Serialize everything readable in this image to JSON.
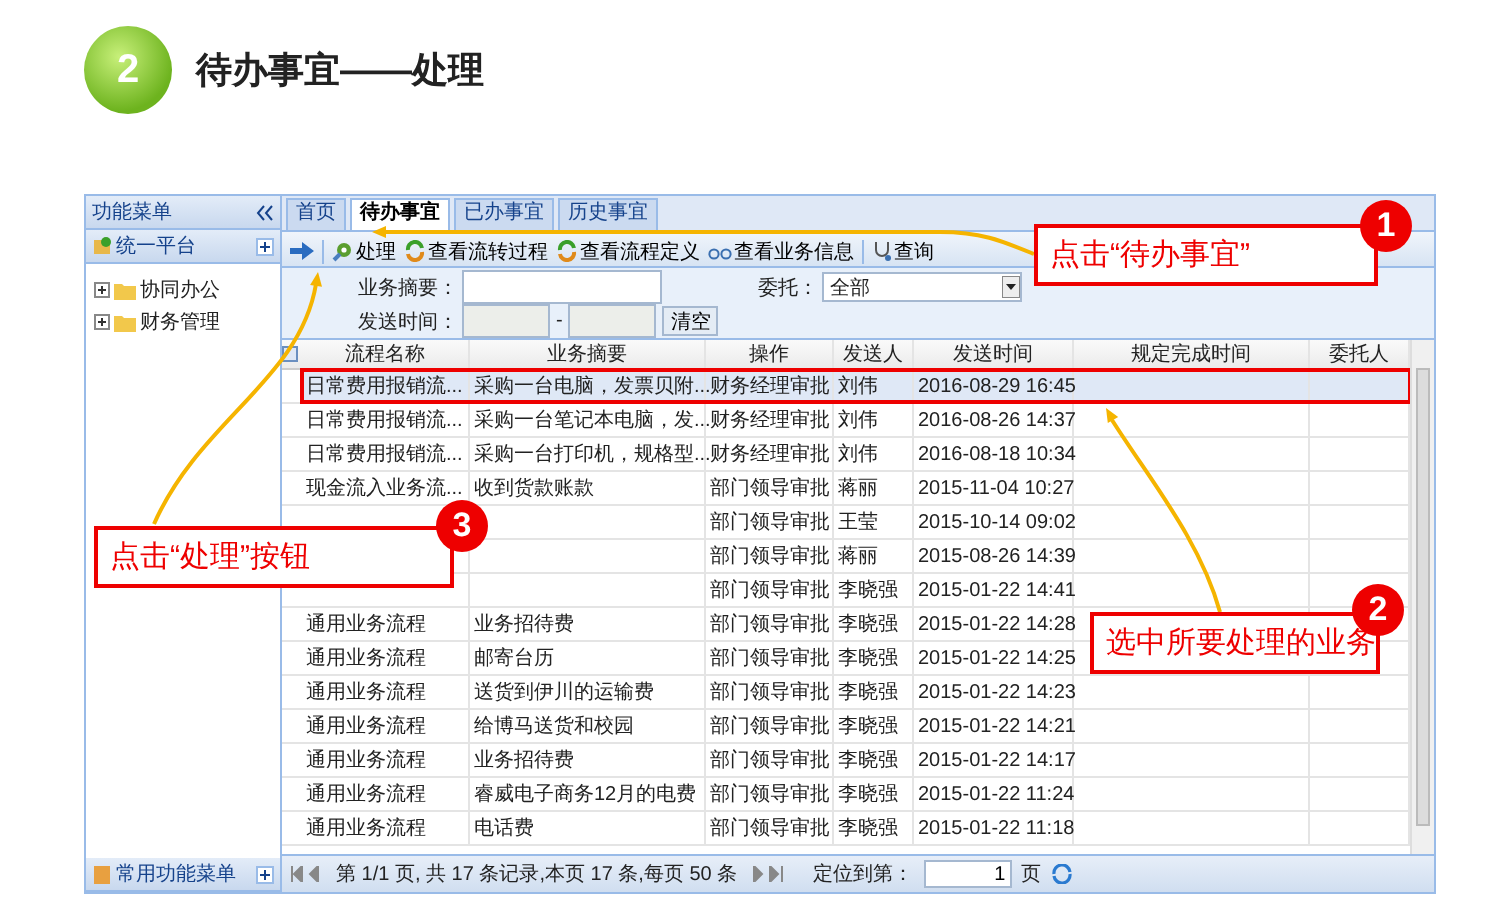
{
  "slide": {
    "step": "2",
    "title": "待办事宜——处理"
  },
  "sidebar": {
    "title": "功能菜单",
    "section": "统一平台",
    "tree": [
      {
        "label": "协同办公",
        "expanded": false
      },
      {
        "label": "财务管理",
        "expanded": false
      }
    ],
    "footer": "常用功能菜单"
  },
  "tabs": [
    {
      "label": "首页",
      "selected": false
    },
    {
      "label": "待办事宜",
      "selected": true
    },
    {
      "label": "已办事宜",
      "selected": false
    },
    {
      "label": "历史事宜",
      "selected": false
    }
  ],
  "toolbar": [
    {
      "label": "处理",
      "kind": "process"
    },
    {
      "label": "查看流转过程",
      "kind": "recycle"
    },
    {
      "label": "查看流程定义",
      "kind": "recycle"
    },
    {
      "label": "查看业务信息",
      "kind": "glasses"
    },
    {
      "label": "查询",
      "kind": "query"
    }
  ],
  "form": {
    "summary_label": "业务摘要：",
    "delegate_label": "委托：",
    "delegate_value": "全部",
    "time_label": "发送时间：",
    "range_separator": "-",
    "clear_button": "清空"
  },
  "table": {
    "columns": [
      "流程名称",
      "业务摘要",
      "操作",
      "发送人",
      "发送时间",
      "规定完成时间",
      "委托人"
    ],
    "rows": [
      {
        "cells": [
          "日常费用报销流...",
          "采购一台电脑，发票贝附...",
          "财务经理审批",
          "刘伟",
          "2016-08-29 16:45"
        ],
        "selected": true
      },
      {
        "cells": [
          "日常费用报销流...",
          "采购一台笔记本电脑，发...",
          "财务经理审批",
          "刘伟",
          "2016-08-26 14:37"
        ],
        "selected": false
      },
      {
        "cells": [
          "日常费用报销流...",
          "采购一台打印机，规格型...",
          "财务经理审批",
          "刘伟",
          "2016-08-18 10:34"
        ],
        "selected": false
      },
      {
        "cells": [
          "现金流入业务流...",
          "收到货款账款",
          "部门领导审批",
          "蒋丽",
          "2015-11-04 10:27"
        ],
        "selected": false
      },
      {
        "cells": [
          null,
          null,
          "部门领导审批",
          "王莹",
          "2015-10-14 09:02"
        ],
        "selected": false
      },
      {
        "cells": [
          null,
          null,
          "部门领导审批",
          "蒋丽",
          "2015-08-26 14:39"
        ],
        "selected": false
      },
      {
        "cells": [
          null,
          null,
          "部门领导审批",
          "李晓强",
          "2015-01-22 14:41"
        ],
        "selected": false
      },
      {
        "cells": [
          "通用业务流程",
          "业务招待费",
          "部门领导审批",
          "李晓强",
          "2015-01-22 14:28"
        ],
        "selected": false
      },
      {
        "cells": [
          "通用业务流程",
          "邮寄台历",
          "部门领导审批",
          "李晓强",
          "2015-01-22 14:25"
        ],
        "selected": false
      },
      {
        "cells": [
          "通用业务流程",
          "送货到伊川的运输费",
          "部门领导审批",
          "李晓强",
          "2015-01-22 14:23"
        ],
        "selected": false
      },
      {
        "cells": [
          "通用业务流程",
          "给博马送货和校园",
          "部门领导审批",
          "李晓强",
          "2015-01-22 14:21"
        ],
        "selected": false
      },
      {
        "cells": [
          "通用业务流程",
          "业务招待费",
          "部门领导审批",
          "李晓强",
          "2015-01-22 14:17"
        ],
        "selected": false
      },
      {
        "cells": [
          "通用业务流程",
          "睿威电子商务12月的电费",
          "部门领导审批",
          "李晓强",
          "2015-01-22 11:24"
        ],
        "selected": false
      },
      {
        "cells": [
          "通用业务流程",
          "电话费",
          "部门领导审批",
          "李晓强",
          "2015-01-22 11:18"
        ],
        "selected": false
      }
    ]
  },
  "pager": {
    "info": "第 1/1 页, 共 17 条记录,本页 17 条,每页 50 条",
    "goto_label": "定位到第：",
    "page_value": "1",
    "page_unit": "页"
  },
  "callouts": [
    {
      "number": "1",
      "text": "点击“待办事宜”"
    },
    {
      "number": "2",
      "text": "选中所要处理的业务"
    },
    {
      "number": "3",
      "text": "点击“处理”按钮"
    }
  ]
}
